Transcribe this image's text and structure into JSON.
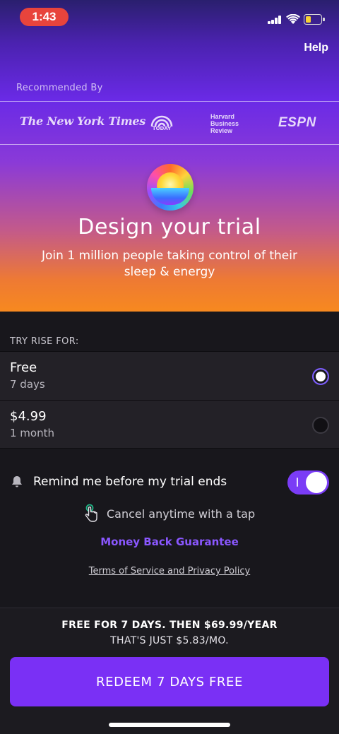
{
  "status_bar": {
    "time": "1:43"
  },
  "header": {
    "help_label": "Help"
  },
  "recommended": {
    "label": "Recommended By",
    "logos": [
      {
        "name": "nyt",
        "text": "The New York Times"
      },
      {
        "name": "today",
        "text": "TODAY"
      },
      {
        "name": "hbr",
        "lines": [
          "Harvard",
          "Business",
          "Review"
        ]
      },
      {
        "name": "espn",
        "text": "ESPN"
      }
    ]
  },
  "hero": {
    "title": "Design your trial",
    "subtitle": "Join 1 million people taking control of their sleep & energy"
  },
  "plans": {
    "section_label": "TRY RISE FOR:",
    "options": [
      {
        "title": "Free",
        "subtitle": "7 days",
        "selected": true
      },
      {
        "title": "$4.99",
        "subtitle": "1 month",
        "selected": false
      }
    ]
  },
  "reminder": {
    "label": "Remind me before my trial ends",
    "enabled": true
  },
  "cancel": {
    "label": "Cancel anytime with a tap"
  },
  "money_back": {
    "label": "Money Back Guarantee"
  },
  "terms": {
    "label": "Terms of Service and Privacy Policy"
  },
  "offer": {
    "line1": "FREE FOR 7 DAYS. THEN $69.99/YEAR",
    "line2": "THAT'S JUST $5.83/MO."
  },
  "cta": {
    "label": "REDEEM 7 DAYS FREE"
  },
  "colors": {
    "accent": "#7a30f5",
    "link": "#8a57ff",
    "background": "#18171c",
    "battery": "#f8d233",
    "status_pill": "#e8443c"
  },
  "status_icons": [
    "signal-icon",
    "wifi-icon",
    "battery-icon"
  ],
  "battery_level": 0.35
}
